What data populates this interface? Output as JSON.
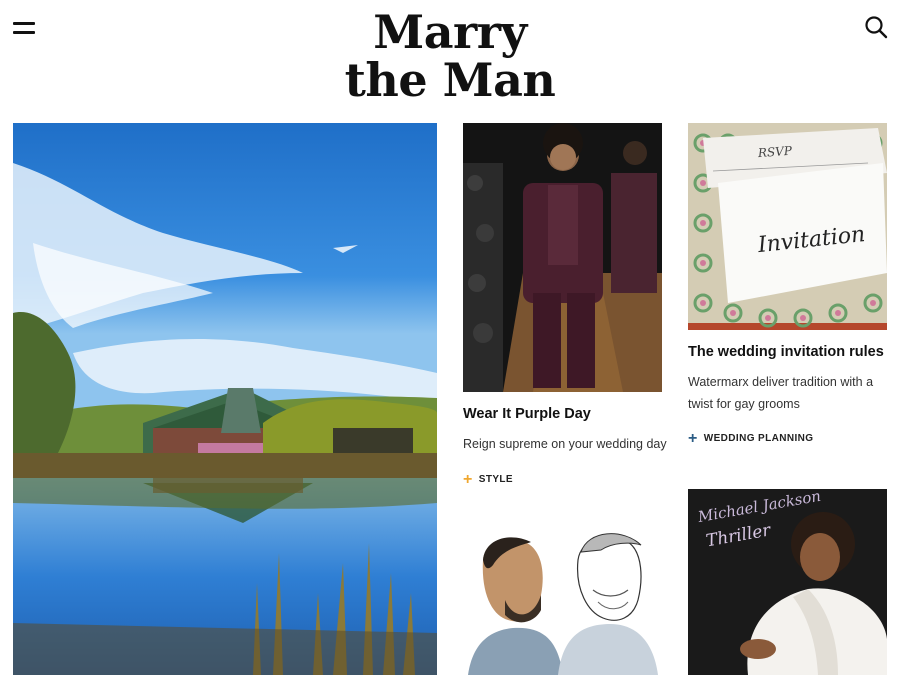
{
  "header": {
    "logo_line1": "Marry",
    "logo_line2": "the Man",
    "menu_icon": "hamburger-icon",
    "search_icon": "search-icon"
  },
  "cards": [
    {
      "title": "Wear It Purple Day",
      "description": "Reign supreme on your wedding day",
      "tag": "STYLE",
      "tag_color": "#f0a830"
    },
    {
      "title": "The wedding invitation rules",
      "description_line1": "Watermarx deliver tradition with a",
      "description_line2": "twist for gay grooms",
      "tag": "WEDDING PLANNING",
      "tag_color": "#2b5c85",
      "invitation_text": "Invitation",
      "rsvp_text": "RSVP"
    },
    {
      "album_artist": "Michael Jackson",
      "album_title": "Thriller"
    }
  ],
  "colors": {
    "style_tag": "#f0a830",
    "planning_tag": "#2b5c85"
  }
}
